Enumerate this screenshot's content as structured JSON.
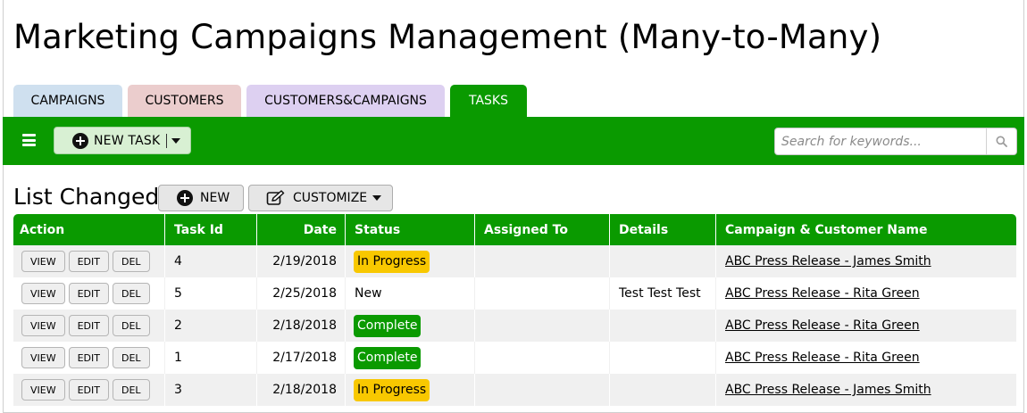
{
  "app": {
    "title": "Marketing Campaigns Management (Many-to-Many)"
  },
  "tabs": [
    {
      "label": "CAMPAIGNS"
    },
    {
      "label": "CUSTOMERS"
    },
    {
      "label": "CUSTOMERS&CAMPAIGNS"
    },
    {
      "label": "TASKS",
      "active": true
    }
  ],
  "toolbar": {
    "new_task_label": "NEW TASK",
    "search_placeholder": "Search for keywords...",
    "search_value": ""
  },
  "list": {
    "title": "List Changed",
    "new_label": "NEW",
    "customize_label": "CUSTOMIZE"
  },
  "columns": {
    "action": "Action",
    "task_id": "Task Id",
    "date": "Date",
    "status": "Status",
    "assigned_to": "Assigned To",
    "details": "Details",
    "campaign_customer": "Campaign & Customer Name"
  },
  "row_buttons": {
    "view": "VIEW",
    "edit": "EDIT",
    "del": "DEL"
  },
  "rows": [
    {
      "task_id": "4",
      "date": "2/19/2018",
      "status": "In Progress",
      "status_style": "prog",
      "assigned_to": "",
      "details": "",
      "campaign_customer": "ABC Press Release - James Smith"
    },
    {
      "task_id": "5",
      "date": "2/25/2018",
      "status": "New",
      "status_style": "plain",
      "assigned_to": "",
      "details": "Test Test Test",
      "campaign_customer": "ABC Press Release - Rita Green"
    },
    {
      "task_id": "2",
      "date": "2/18/2018",
      "status": "Complete",
      "status_style": "comp",
      "assigned_to": "",
      "details": "",
      "campaign_customer": "ABC Press Release - Rita Green"
    },
    {
      "task_id": "1",
      "date": "2/17/2018",
      "status": "Complete",
      "status_style": "comp",
      "assigned_to": "",
      "details": "",
      "campaign_customer": "ABC Press Release - Rita Green"
    },
    {
      "task_id": "3",
      "date": "2/18/2018",
      "status": "In Progress",
      "status_style": "prog",
      "assigned_to": "",
      "details": "",
      "campaign_customer": "ABC Press Release - James Smith"
    }
  ],
  "colors": {
    "accent_green": "#0a9a00",
    "in_progress": "#f8c800",
    "tab_campaigns": "#cfe0ef",
    "tab_customers": "#ebcdcd",
    "tab_customers_campaigns": "#ddd0f1"
  },
  "icons": {
    "menu": "hamburger-icon",
    "add": "plus-circle-icon",
    "dropdown": "caret-down-icon",
    "search": "search-icon",
    "customize": "edit-icon"
  }
}
